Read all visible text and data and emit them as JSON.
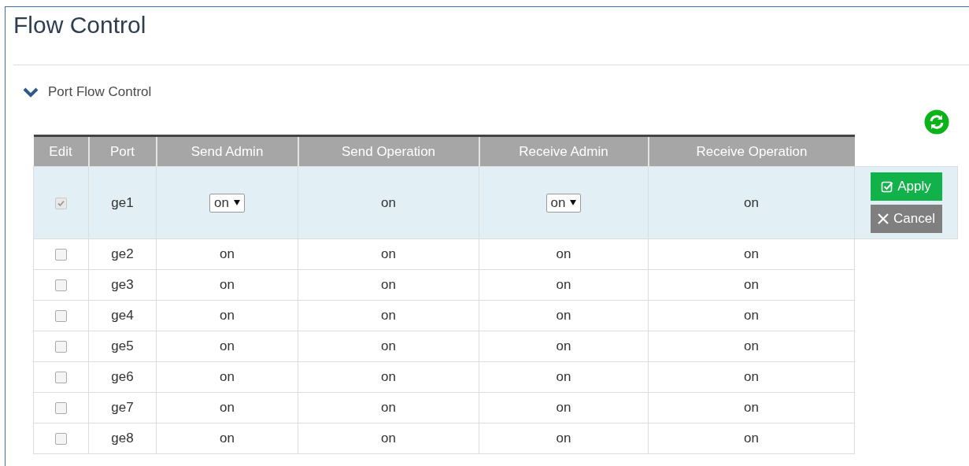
{
  "title": "Flow Control",
  "section": {
    "label": "Port Flow Control",
    "expanded": true
  },
  "table": {
    "columns": [
      "Edit",
      "Port",
      "Send Admin",
      "Send Operation",
      "Receive Admin",
      "Receive Operation"
    ],
    "rows": [
      {
        "checked": true,
        "disabled": true,
        "editing": true,
        "port": "ge1",
        "send_admin": "on",
        "send_operation": "on",
        "receive_admin": "on",
        "receive_operation": "on"
      },
      {
        "checked": false,
        "disabled": false,
        "editing": false,
        "port": "ge2",
        "send_admin": "on",
        "send_operation": "on",
        "receive_admin": "on",
        "receive_operation": "on"
      },
      {
        "checked": false,
        "disabled": false,
        "editing": false,
        "port": "ge3",
        "send_admin": "on",
        "send_operation": "on",
        "receive_admin": "on",
        "receive_operation": "on"
      },
      {
        "checked": false,
        "disabled": false,
        "editing": false,
        "port": "ge4",
        "send_admin": "on",
        "send_operation": "on",
        "receive_admin": "on",
        "receive_operation": "on"
      },
      {
        "checked": false,
        "disabled": false,
        "editing": false,
        "port": "ge5",
        "send_admin": "on",
        "send_operation": "on",
        "receive_admin": "on",
        "receive_operation": "on"
      },
      {
        "checked": false,
        "disabled": false,
        "editing": false,
        "port": "ge6",
        "send_admin": "on",
        "send_operation": "on",
        "receive_admin": "on",
        "receive_operation": "on"
      },
      {
        "checked": false,
        "disabled": false,
        "editing": false,
        "port": "ge7",
        "send_admin": "on",
        "send_operation": "on",
        "receive_admin": "on",
        "receive_operation": "on"
      },
      {
        "checked": false,
        "disabled": false,
        "editing": false,
        "port": "ge8",
        "send_admin": "on",
        "send_operation": "on",
        "receive_admin": "on",
        "receive_operation": "on"
      }
    ]
  },
  "buttons": {
    "apply": "Apply",
    "cancel": "Cancel"
  }
}
